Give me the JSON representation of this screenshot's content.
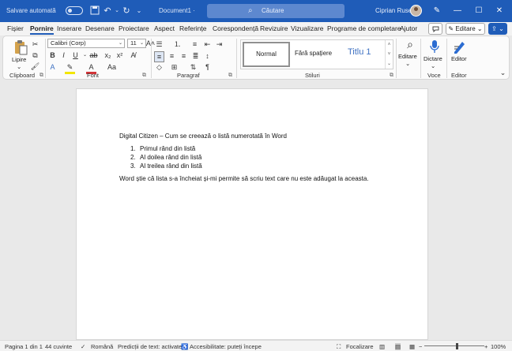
{
  "titlebar": {
    "autosave_label": "Salvare automată",
    "doc_title": "Document1 ·",
    "search_placeholder": "Căutare",
    "user_name": "Ciprian Rusen"
  },
  "tabs": [
    "Fișier",
    "Pornire",
    "Inserare",
    "Desenare",
    "Proiectare",
    "Aspect",
    "Referințe",
    "Corespondență",
    "Revizuire",
    "Vizualizare",
    "Programe de completare",
    "Ajutor"
  ],
  "active_tab": "Pornire",
  "ribbon_right": {
    "editing_label": "Editare",
    "editing_icon": "pencil-icon"
  },
  "clipboard": {
    "paste_label": "Lipire",
    "group_label": "Clipboard"
  },
  "font": {
    "family": "Calibri (Corp)",
    "size": "11",
    "group_label": "Font"
  },
  "paragraph": {
    "group_label": "Paragraf"
  },
  "styles": {
    "items": [
      "Normal",
      "Fără spațiere",
      "Titlu 1"
    ],
    "group_label": "Stiluri"
  },
  "editing": {
    "label": "Editare"
  },
  "voice": {
    "dictate_label": "Dictare",
    "group_label": "Voce"
  },
  "editor": {
    "label": "Editor",
    "group_label": "Editor"
  },
  "document": {
    "title_line": "Digital Citizen – Cum se creează o listă numerotată în Word",
    "list": [
      {
        "num": "1.",
        "text": "Primul rând din listă"
      },
      {
        "num": "2.",
        "text": "Al doilea rând din listă"
      },
      {
        "num": "3.",
        "text": "Al treilea rând din listă"
      }
    ],
    "closing_line": "Word știe că lista s-a încheiat și-mi permite să scriu text care nu este adăugat la aceasta."
  },
  "status": {
    "page": "Pagina 1 din 1",
    "words": "44 cuvinte",
    "language": "Română",
    "predictions": "Predicții de text: activate",
    "accessibility": "Accesibilitate: puteți începe",
    "focus": "Focalizare",
    "zoom": "100%"
  },
  "colors": {
    "accent": "#1f5cb8",
    "title_style": "#3e71c2"
  }
}
